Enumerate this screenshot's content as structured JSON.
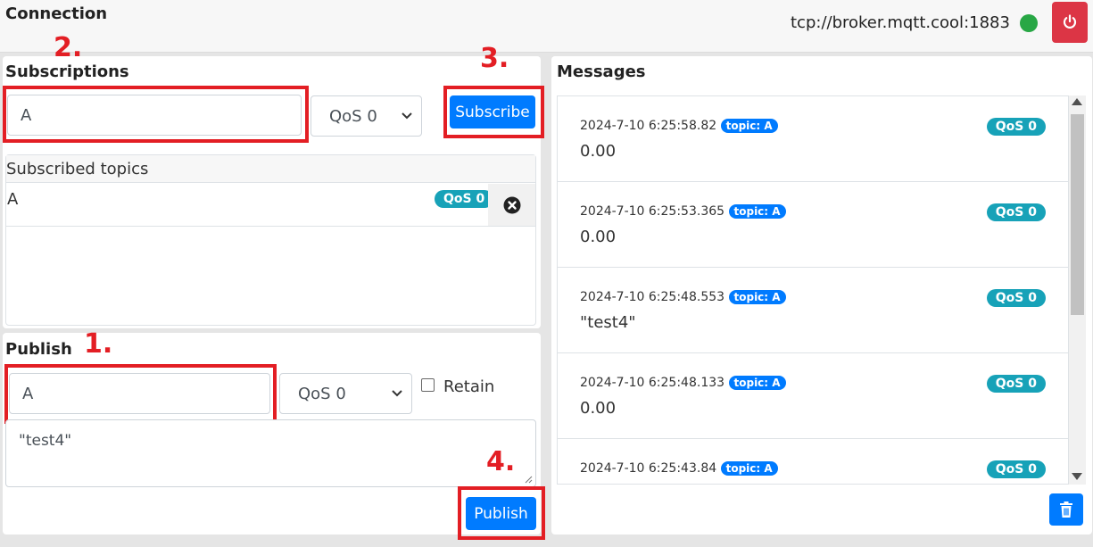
{
  "connection": {
    "title": "Connection",
    "url": "tcp://broker.mqtt.cool:1883",
    "status_color": "#28a745",
    "disconnect_icon": "power-icon"
  },
  "subscriptions": {
    "title": "Subscriptions",
    "topic_value": "A",
    "qos_selected": "QoS 0",
    "subscribe_label": "Subscribe",
    "subscribed_header": "Subscribed topics",
    "topics": [
      {
        "name": "A",
        "qos": "QoS 0"
      }
    ]
  },
  "publish": {
    "title": "Publish",
    "topic_value": "A",
    "qos_selected": "QoS 0",
    "retain_label": "Retain",
    "retain_checked": false,
    "payload_value": "\"test4\"",
    "publish_label": "Publish"
  },
  "messages": {
    "title": "Messages",
    "items": [
      {
        "time": "2024-7-10 6:25:58.82",
        "topic": "topic: A",
        "payload": "0.00",
        "qos": "QoS 0"
      },
      {
        "time": "2024-7-10 6:25:53.365",
        "topic": "topic: A",
        "payload": "0.00",
        "qos": "QoS 0"
      },
      {
        "time": "2024-7-10 6:25:48.553",
        "topic": "topic: A",
        "payload": "\"test4\"",
        "qos": "QoS 0"
      },
      {
        "time": "2024-7-10 6:25:48.133",
        "topic": "topic: A",
        "payload": "0.00",
        "qos": "QoS 0"
      },
      {
        "time": "2024-7-10 6:25:43.84",
        "topic": "topic: A",
        "payload": "",
        "qos": "QoS 0"
      }
    ],
    "clear_icon": "trash-icon"
  },
  "annotations": {
    "step1": "1.",
    "step2": "2.",
    "step3": "3.",
    "step4": "4.",
    "highlight_color": "#e31e24"
  },
  "colors": {
    "primary": "#007bff",
    "danger": "#dc3545",
    "info": "#17a2b8"
  }
}
